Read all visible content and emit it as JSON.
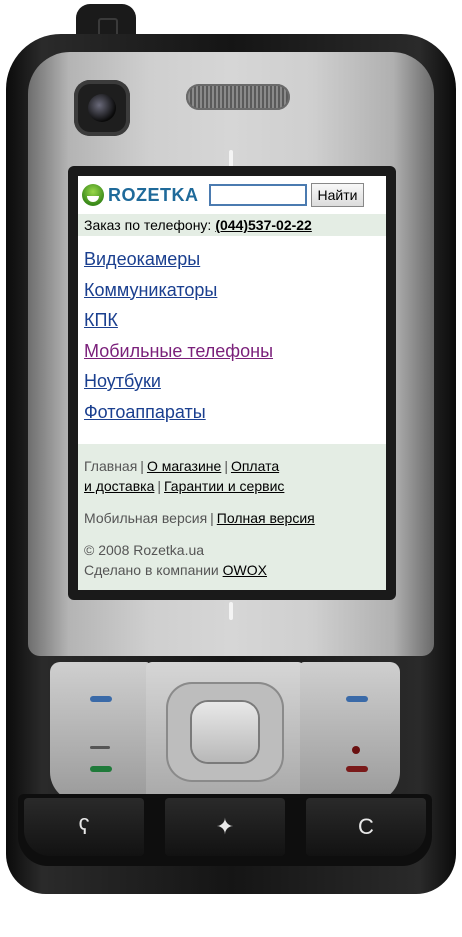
{
  "header": {
    "logo_text": "ROZETKA",
    "search_placeholder": "",
    "search_button": "Найти"
  },
  "order_line": {
    "label": "Заказ по телефону:",
    "number": "(044)537-02-22"
  },
  "categories": [
    {
      "label": "Видеокамеры",
      "visited": false
    },
    {
      "label": "Коммуникаторы",
      "visited": false
    },
    {
      "label": "КПК",
      "visited": false
    },
    {
      "label": "Мобильные телефоны",
      "visited": true
    },
    {
      "label": "Ноутбуки",
      "visited": false
    },
    {
      "label": "Фотоаппараты",
      "visited": false
    }
  ],
  "footer": {
    "home": "Главная",
    "about": "О магазине",
    "payment_line1": "Оплата",
    "payment_line2": "и доставка",
    "warranty": "Гарантии и сервис",
    "mobile_version": "Мобильная версия",
    "full_version": "Полная версия",
    "copyright": "© 2008 Rozetka.ua",
    "made_by": "Сделано в компании",
    "made_by_link": "OWOX"
  },
  "separators": {
    "pipe": "|"
  },
  "device_keys": {
    "clear_key": "C",
    "menu_key_icon": "menu-icon",
    "center_key_icon": "star-icon"
  },
  "colors": {
    "link": "#1a3f8f",
    "visited_link": "#7a1f7a",
    "band": "#e4ede4",
    "logo": "#1f6a9a"
  }
}
